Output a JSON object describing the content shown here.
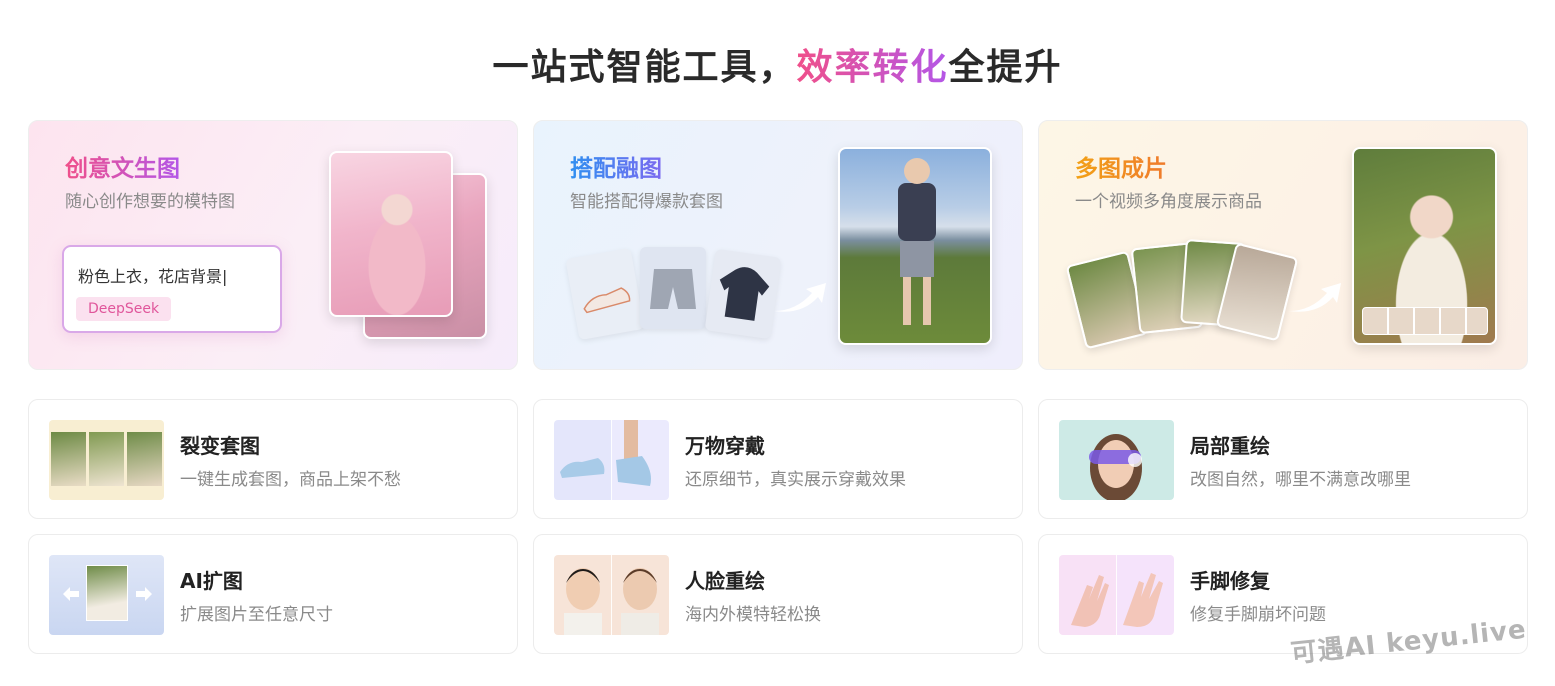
{
  "headline": {
    "before": "一站式智能工具，",
    "highlight": "效率转化",
    "after": "全提升"
  },
  "features": [
    {
      "title": "创意文生图",
      "subtitle": "随心创作想要的模特图",
      "prompt_text": "粉色上衣，花店背景|",
      "chip": "DeepSeek",
      "accent": "#f0508a"
    },
    {
      "title": "搭配融图",
      "subtitle": "智能搭配得爆款套图",
      "accent": "#2f8ff0"
    },
    {
      "title": "多图成片",
      "subtitle": "一个视频多角度展示商品",
      "accent": "#f2a116"
    }
  ],
  "tools": [
    {
      "name": "裂变套图",
      "desc": "一键生成套图，商品上架不愁"
    },
    {
      "name": "万物穿戴",
      "desc": "还原细节，真实展示穿戴效果"
    },
    {
      "name": "局部重绘",
      "desc": "改图自然，哪里不满意改哪里"
    },
    {
      "name": "AI扩图",
      "desc": "扩展图片至任意尺寸"
    },
    {
      "name": "人脸重绘",
      "desc": "海内外模特轻松换"
    },
    {
      "name": "手脚修复",
      "desc": "修复手脚崩坏问题"
    }
  ],
  "watermark": "可遇AI keyu.live"
}
